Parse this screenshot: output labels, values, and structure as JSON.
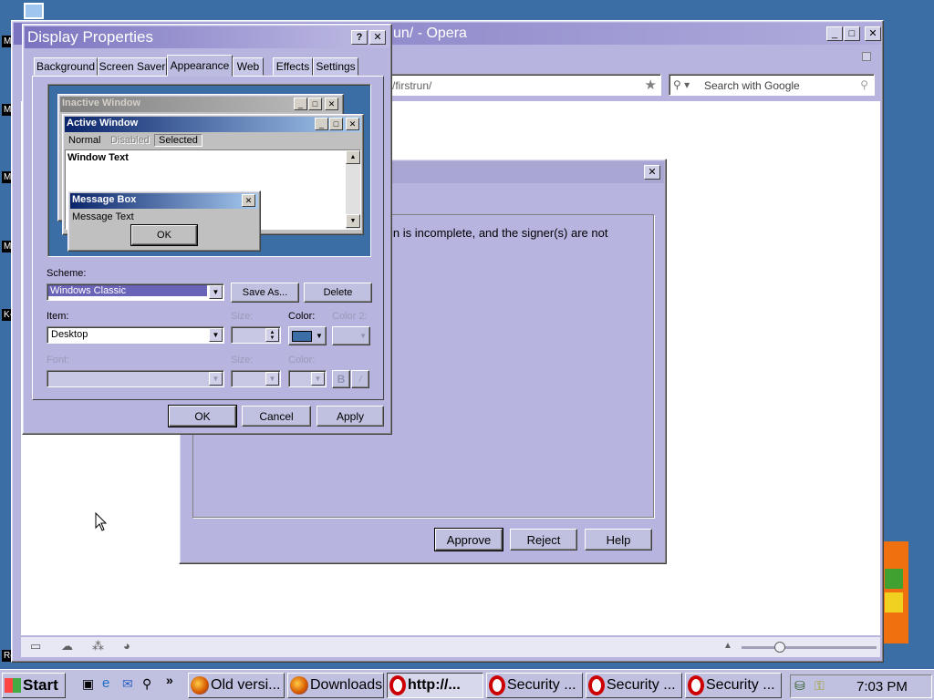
{
  "desktop": {
    "icon_labels": [
      "My",
      "My",
      "My",
      "Moz",
      "K-M",
      "Re"
    ]
  },
  "opera": {
    "title": "un/ - Opera",
    "address": "/firstrun/",
    "search_placeholder": "Search with Google"
  },
  "security_dialog": {
    "message": "in is incomplete, and the signer(s) are not",
    "buttons": {
      "approve": "Approve",
      "reject": "Reject",
      "help": "Help"
    }
  },
  "display_properties": {
    "title": "Display Properties",
    "tabs": [
      "Background",
      "Screen Saver",
      "Appearance",
      "Web",
      "Effects",
      "Settings"
    ],
    "active_tab": "Appearance",
    "preview": {
      "inactive_title": "Inactive Window",
      "active_title": "Active Window",
      "menu": {
        "normal": "Normal",
        "disabled": "Disabled",
        "selected": "Selected"
      },
      "window_text": "Window Text",
      "msgbox_title": "Message Box",
      "msgbox_text": "Message Text",
      "msgbox_ok": "OK"
    },
    "scheme_label": "Scheme:",
    "scheme_value": "Windows Classic",
    "save_as": "Save As...",
    "delete": "Delete",
    "item_label": "Item:",
    "item_value": "Desktop",
    "size_label": "Size:",
    "color_label": "Color:",
    "color2_label": "Color 2:",
    "font_label": "Font:",
    "font_size_label": "Size:",
    "font_color_label": "Color:",
    "bold": "B",
    "italic": "/",
    "color_swatch": "#3a6ea5",
    "buttons": {
      "ok": "OK",
      "cancel": "Cancel",
      "apply": "Apply"
    }
  },
  "taskbar": {
    "start": "Start",
    "items": [
      {
        "label": "Old versi...",
        "icon": "firefox-icon"
      },
      {
        "label": "Downloads",
        "icon": "firefox-icon"
      },
      {
        "label": "http://...",
        "icon": "opera-icon"
      },
      {
        "label": "Security ...",
        "icon": "opera-icon"
      },
      {
        "label": "Security ...",
        "icon": "opera-icon"
      },
      {
        "label": "Security ...",
        "icon": "opera-icon"
      }
    ],
    "more": "»",
    "clock": "7:03 PM"
  },
  "colors": {
    "desktop": "#3a6ea5",
    "chrome": "#c0c0e0",
    "active_title_start": "#0a246a",
    "active_title_end": "#a6caf0"
  }
}
